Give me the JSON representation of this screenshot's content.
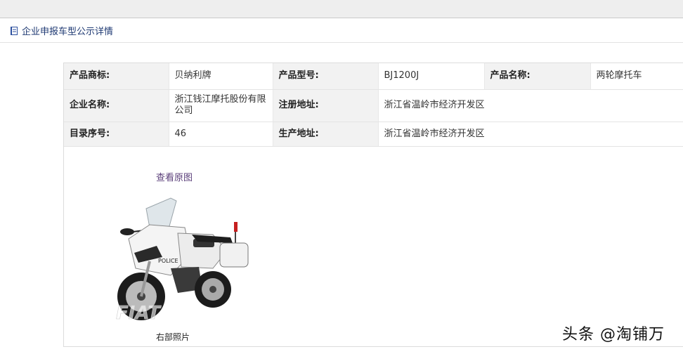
{
  "header": {
    "title": "企业申报车型公示详情"
  },
  "info": {
    "brand_label": "产品商标:",
    "brand_value": "贝纳利牌",
    "model_label": "产品型号:",
    "model_value": "BJ1200J",
    "name_label": "产品名称:",
    "name_value": "两轮摩托车",
    "company_label": "企业名称:",
    "company_value": "浙江钱江摩托股份有限公司",
    "reg_addr_label": "注册地址:",
    "reg_addr_value": "浙江省温岭市经济开发区",
    "catalog_label": "目录序号:",
    "catalog_value": "46",
    "prod_addr_label": "生产地址:",
    "prod_addr_value": "浙江省温岭市经济开发区"
  },
  "photo": {
    "view_original": "查看原图",
    "caption": "右部照片",
    "livery_text": "POLICE",
    "overlay_text": "FIAT"
  },
  "watermark": "头条 @淘铺万",
  "icons": {
    "header": "book-icon"
  }
}
